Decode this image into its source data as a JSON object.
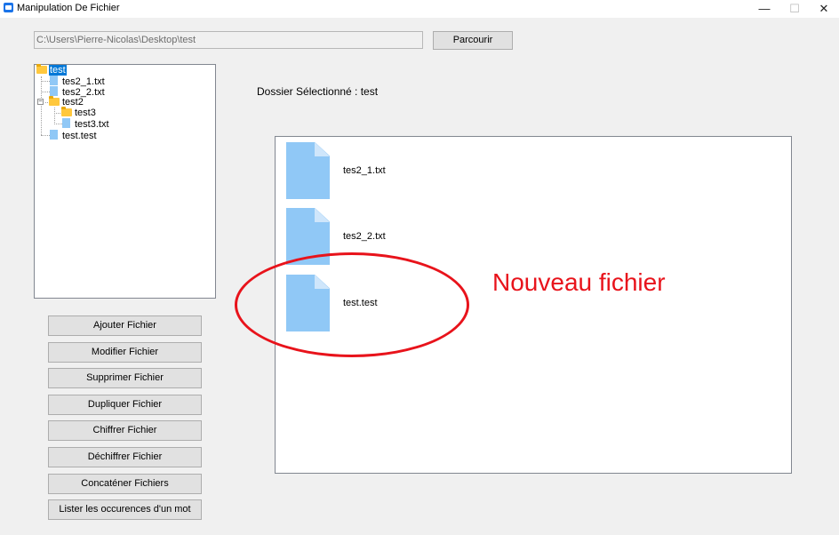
{
  "window": {
    "title": "Manipulation De Fichier",
    "controls": {
      "minimize": "—",
      "maximize": "☐",
      "close": "✕"
    }
  },
  "path_bar": {
    "value": "C:\\Users\\Pierre-Nicolas\\Desktop\\test",
    "browse_label": "Parcourir"
  },
  "tree": {
    "root": "test",
    "items": [
      "tes2_1.txt",
      "tes2_2.txt",
      "test2",
      "test3",
      "test3.txt",
      "test.test"
    ]
  },
  "actions": [
    "Ajouter Fichier",
    "Modifier Fichier",
    "Supprimer Fichier",
    "Dupliquer Fichier",
    "Chiffrer Fichier",
    "Déchiffrer Fichier",
    "Concaténer Fichiers",
    "Lister les occurences d'un mot"
  ],
  "selected_folder_label": "Dossier Sélectionné : test",
  "files": [
    "tes2_1.txt",
    "tes2_2.txt",
    "test.test"
  ],
  "annotation": {
    "text": "Nouveau fichier",
    "color": "#e8131b"
  },
  "colors": {
    "selection": "#0078d7",
    "file_icon": "#90c8f6",
    "folder_icon": "#ffc83d"
  }
}
